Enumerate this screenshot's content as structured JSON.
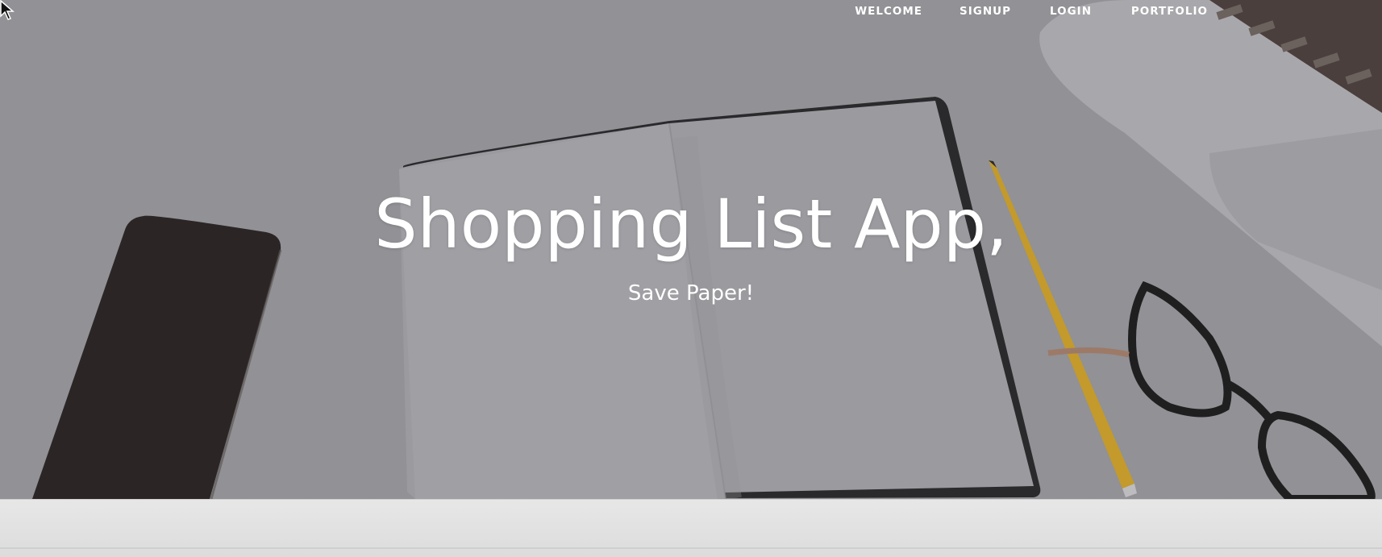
{
  "nav": {
    "items": [
      {
        "label": "WELCOME"
      },
      {
        "label": "SIGNUP"
      },
      {
        "label": "LOGIN"
      },
      {
        "label": "PORTFOLIO"
      }
    ]
  },
  "hero": {
    "title": "Shopping List App,",
    "subtitle": "Save Paper!"
  },
  "colors": {
    "overlay": "#8e8e93",
    "text": "#ffffff",
    "footer": "#e2e2e2"
  },
  "icons": [
    "mouse-cursor-icon"
  ]
}
